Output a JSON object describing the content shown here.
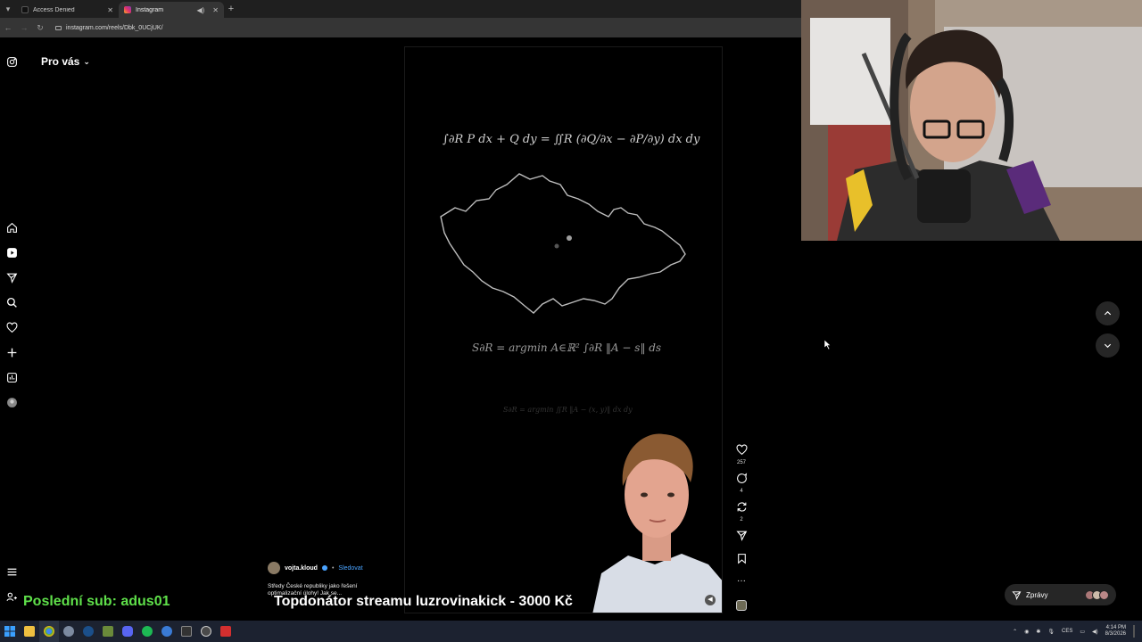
{
  "browser": {
    "tabs": [
      {
        "title": "Access Denied",
        "active": false
      },
      {
        "title": "Instagram",
        "active": true
      }
    ],
    "url": "instagram.com/reels/Dbk_0UCjUK/"
  },
  "instagram": {
    "feed_title": "Pro vás",
    "reel": {
      "formula_green": "∫∂R P dx + Q dy = ∬R (∂Q/∂x − ∂P/∂y) dx dy",
      "formula_argmin": "S∂R = argmin A∈ℝ² ∫∂R ‖A − s‖ ds",
      "formula_faint": "S∂R = argmin ∬R ‖A − (x, y)‖ dx dy",
      "author": "vojta.kloud",
      "follow_label": "Sledovat",
      "caption": "Středy České republiky jako řešení optimalizační úlohy! Jak se..."
    },
    "actions": {
      "likes": "257",
      "comments": "4",
      "reposts": "2"
    },
    "messages_label": "Zprávy"
  },
  "overlays": {
    "last_sub": "Poslední sub: adus01",
    "top_donor": "Topdonátor streamu luzrovinakick - 3000 Kč"
  },
  "taskbar": {
    "language": "CES",
    "time": "4:14 PM",
    "date": "8/3/2026"
  },
  "colors": {
    "overlay_green": "#5fe04a",
    "follow_blue": "#4aa3ff",
    "taskbar_bg": "#1c2230"
  }
}
